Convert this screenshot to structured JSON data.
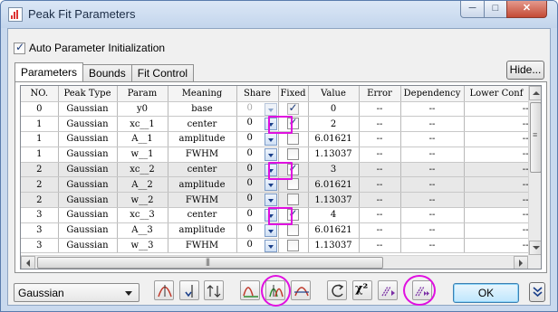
{
  "window": {
    "title": "Peak Fit Parameters",
    "controls": {
      "minimize": "─",
      "maximize": "□",
      "close": "✕"
    }
  },
  "auto_init": {
    "label": "Auto Parameter Initialization",
    "checked": true
  },
  "tabs": [
    {
      "label": "Parameters",
      "active": true
    },
    {
      "label": "Bounds",
      "active": false
    },
    {
      "label": "Fit Control",
      "active": false
    }
  ],
  "hide_button": {
    "label": "Hide..."
  },
  "table": {
    "columns": [
      "NO.",
      "Peak Type",
      "Param",
      "Meaning",
      "Share",
      "Fixed",
      "Value",
      "Error",
      "Dependency",
      "Lower Conf"
    ],
    "rows": [
      {
        "no": "0",
        "peak_type": "Gaussian",
        "param": "y0",
        "meaning": "base",
        "share": "0",
        "fixed": true,
        "value": "0",
        "error": "--",
        "dependency": "--",
        "lower": "--",
        "shaded": false,
        "share_disabled": true
      },
      {
        "no": "1",
        "peak_type": "Gaussian",
        "param": "xc__1",
        "meaning": "center",
        "share": "0",
        "fixed": true,
        "value": "2",
        "error": "--",
        "dependency": "--",
        "lower": "--",
        "shaded": false,
        "share_disabled": false
      },
      {
        "no": "1",
        "peak_type": "Gaussian",
        "param": "A__1",
        "meaning": "amplitude",
        "share": "0",
        "fixed": false,
        "value": "6.01621",
        "error": "--",
        "dependency": "--",
        "lower": "--",
        "shaded": false,
        "share_disabled": false
      },
      {
        "no": "1",
        "peak_type": "Gaussian",
        "param": "w__1",
        "meaning": "FWHM",
        "share": "0",
        "fixed": false,
        "value": "1.13037",
        "error": "--",
        "dependency": "--",
        "lower": "--",
        "shaded": false,
        "share_disabled": false
      },
      {
        "no": "2",
        "peak_type": "Gaussian",
        "param": "xc__2",
        "meaning": "center",
        "share": "0",
        "fixed": true,
        "value": "3",
        "error": "--",
        "dependency": "--",
        "lower": "--",
        "shaded": true,
        "share_disabled": false
      },
      {
        "no": "2",
        "peak_type": "Gaussian",
        "param": "A__2",
        "meaning": "amplitude",
        "share": "0",
        "fixed": false,
        "value": "6.01621",
        "error": "--",
        "dependency": "--",
        "lower": "--",
        "shaded": true,
        "share_disabled": false
      },
      {
        "no": "2",
        "peak_type": "Gaussian",
        "param": "w__2",
        "meaning": "FWHM",
        "share": "0",
        "fixed": false,
        "value": "1.13037",
        "error": "--",
        "dependency": "--",
        "lower": "--",
        "shaded": true,
        "share_disabled": false
      },
      {
        "no": "3",
        "peak_type": "Gaussian",
        "param": "xc__3",
        "meaning": "center",
        "share": "0",
        "fixed": true,
        "value": "4",
        "error": "--",
        "dependency": "--",
        "lower": "--",
        "shaded": false,
        "share_disabled": false
      },
      {
        "no": "3",
        "peak_type": "Gaussian",
        "param": "A__3",
        "meaning": "amplitude",
        "share": "0",
        "fixed": false,
        "value": "6.01621",
        "error": "--",
        "dependency": "--",
        "lower": "--",
        "shaded": false,
        "share_disabled": false
      },
      {
        "no": "3",
        "peak_type": "Gaussian",
        "param": "w__3",
        "meaning": "FWHM",
        "share": "0",
        "fixed": false,
        "value": "1.13037",
        "error": "--",
        "dependency": "--",
        "lower": "--",
        "shaded": false,
        "share_disabled": false
      }
    ]
  },
  "bottom": {
    "function_select": {
      "value": "Gaussian"
    },
    "ok_label": "OK",
    "toolbar_icons": [
      "peak-add-icon",
      "peak-remove-icon",
      "peak-sort-icon",
      "initialize-icon",
      "fix-center-icon",
      "baseline-icon",
      "reset-icon",
      "chi-square-icon",
      "one-iteration-icon",
      "fit-until-converged-icon"
    ],
    "chi_label": "χ²"
  },
  "colors": {
    "highlight": "#e010e0",
    "title_bar": "#c3d5ec",
    "ok_button": "#bee6fd"
  }
}
